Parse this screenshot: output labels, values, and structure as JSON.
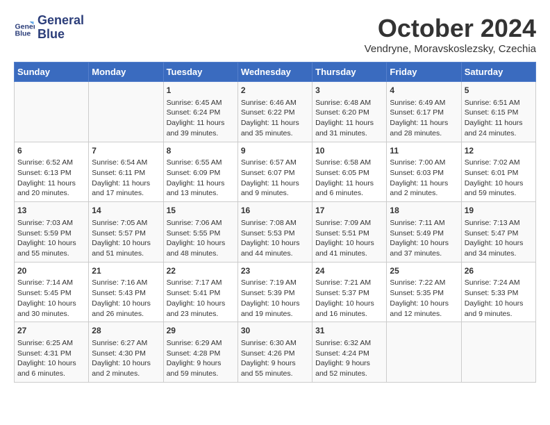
{
  "header": {
    "logo_line1": "General",
    "logo_line2": "Blue",
    "month": "October 2024",
    "location": "Vendryne, Moravskoslezsky, Czechia"
  },
  "days_of_week": [
    "Sunday",
    "Monday",
    "Tuesday",
    "Wednesday",
    "Thursday",
    "Friday",
    "Saturday"
  ],
  "weeks": [
    [
      {
        "day": "",
        "data": ""
      },
      {
        "day": "",
        "data": ""
      },
      {
        "day": "1",
        "data": "Sunrise: 6:45 AM\nSunset: 6:24 PM\nDaylight: 11 hours and 39 minutes."
      },
      {
        "day": "2",
        "data": "Sunrise: 6:46 AM\nSunset: 6:22 PM\nDaylight: 11 hours and 35 minutes."
      },
      {
        "day": "3",
        "data": "Sunrise: 6:48 AM\nSunset: 6:20 PM\nDaylight: 11 hours and 31 minutes."
      },
      {
        "day": "4",
        "data": "Sunrise: 6:49 AM\nSunset: 6:17 PM\nDaylight: 11 hours and 28 minutes."
      },
      {
        "day": "5",
        "data": "Sunrise: 6:51 AM\nSunset: 6:15 PM\nDaylight: 11 hours and 24 minutes."
      }
    ],
    [
      {
        "day": "6",
        "data": "Sunrise: 6:52 AM\nSunset: 6:13 PM\nDaylight: 11 hours and 20 minutes."
      },
      {
        "day": "7",
        "data": "Sunrise: 6:54 AM\nSunset: 6:11 PM\nDaylight: 11 hours and 17 minutes."
      },
      {
        "day": "8",
        "data": "Sunrise: 6:55 AM\nSunset: 6:09 PM\nDaylight: 11 hours and 13 minutes."
      },
      {
        "day": "9",
        "data": "Sunrise: 6:57 AM\nSunset: 6:07 PM\nDaylight: 11 hours and 9 minutes."
      },
      {
        "day": "10",
        "data": "Sunrise: 6:58 AM\nSunset: 6:05 PM\nDaylight: 11 hours and 6 minutes."
      },
      {
        "day": "11",
        "data": "Sunrise: 7:00 AM\nSunset: 6:03 PM\nDaylight: 11 hours and 2 minutes."
      },
      {
        "day": "12",
        "data": "Sunrise: 7:02 AM\nSunset: 6:01 PM\nDaylight: 10 hours and 59 minutes."
      }
    ],
    [
      {
        "day": "13",
        "data": "Sunrise: 7:03 AM\nSunset: 5:59 PM\nDaylight: 10 hours and 55 minutes."
      },
      {
        "day": "14",
        "data": "Sunrise: 7:05 AM\nSunset: 5:57 PM\nDaylight: 10 hours and 51 minutes."
      },
      {
        "day": "15",
        "data": "Sunrise: 7:06 AM\nSunset: 5:55 PM\nDaylight: 10 hours and 48 minutes."
      },
      {
        "day": "16",
        "data": "Sunrise: 7:08 AM\nSunset: 5:53 PM\nDaylight: 10 hours and 44 minutes."
      },
      {
        "day": "17",
        "data": "Sunrise: 7:09 AM\nSunset: 5:51 PM\nDaylight: 10 hours and 41 minutes."
      },
      {
        "day": "18",
        "data": "Sunrise: 7:11 AM\nSunset: 5:49 PM\nDaylight: 10 hours and 37 minutes."
      },
      {
        "day": "19",
        "data": "Sunrise: 7:13 AM\nSunset: 5:47 PM\nDaylight: 10 hours and 34 minutes."
      }
    ],
    [
      {
        "day": "20",
        "data": "Sunrise: 7:14 AM\nSunset: 5:45 PM\nDaylight: 10 hours and 30 minutes."
      },
      {
        "day": "21",
        "data": "Sunrise: 7:16 AM\nSunset: 5:43 PM\nDaylight: 10 hours and 26 minutes."
      },
      {
        "day": "22",
        "data": "Sunrise: 7:17 AM\nSunset: 5:41 PM\nDaylight: 10 hours and 23 minutes."
      },
      {
        "day": "23",
        "data": "Sunrise: 7:19 AM\nSunset: 5:39 PM\nDaylight: 10 hours and 19 minutes."
      },
      {
        "day": "24",
        "data": "Sunrise: 7:21 AM\nSunset: 5:37 PM\nDaylight: 10 hours and 16 minutes."
      },
      {
        "day": "25",
        "data": "Sunrise: 7:22 AM\nSunset: 5:35 PM\nDaylight: 10 hours and 12 minutes."
      },
      {
        "day": "26",
        "data": "Sunrise: 7:24 AM\nSunset: 5:33 PM\nDaylight: 10 hours and 9 minutes."
      }
    ],
    [
      {
        "day": "27",
        "data": "Sunrise: 6:25 AM\nSunset: 4:31 PM\nDaylight: 10 hours and 6 minutes."
      },
      {
        "day": "28",
        "data": "Sunrise: 6:27 AM\nSunset: 4:30 PM\nDaylight: 10 hours and 2 minutes."
      },
      {
        "day": "29",
        "data": "Sunrise: 6:29 AM\nSunset: 4:28 PM\nDaylight: 9 hours and 59 minutes."
      },
      {
        "day": "30",
        "data": "Sunrise: 6:30 AM\nSunset: 4:26 PM\nDaylight: 9 hours and 55 minutes."
      },
      {
        "day": "31",
        "data": "Sunrise: 6:32 AM\nSunset: 4:24 PM\nDaylight: 9 hours and 52 minutes."
      },
      {
        "day": "",
        "data": ""
      },
      {
        "day": "",
        "data": ""
      }
    ]
  ]
}
